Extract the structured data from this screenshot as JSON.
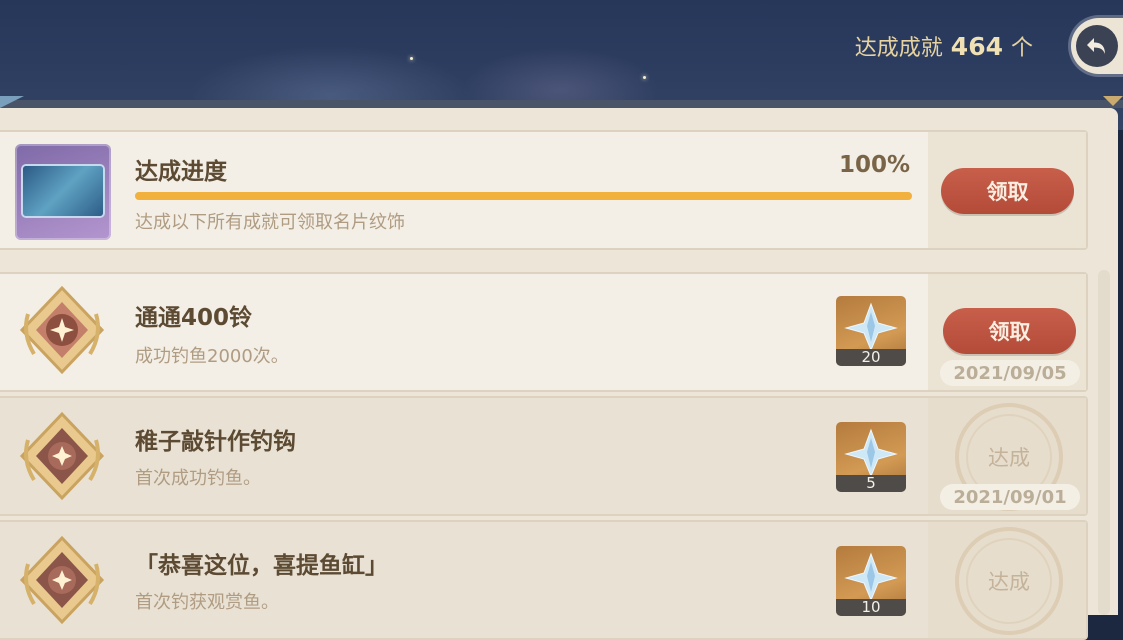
{
  "header": {
    "achieved_label": "达成成就",
    "achieved_count": "464",
    "unit": "个"
  },
  "progress": {
    "title": "达成进度",
    "percent_text": "100%",
    "fraction": 1.0,
    "subtitle": "达成以下所有成就可领取名片纹饰",
    "claim_label": "领取"
  },
  "achievements": [
    {
      "title": "通通400铃",
      "desc": "成功钓鱼2000次。",
      "reward_qty": "20",
      "action": "领取",
      "date": "2021/09/05"
    },
    {
      "title": "稚子敲针作钓钩",
      "desc": "首次成功钓鱼。",
      "reward_qty": "5",
      "stamp": "达成",
      "date": "2021/09/01"
    },
    {
      "title": "「恭喜这位，喜提鱼缸」",
      "desc": "首次钓获观赏鱼。",
      "reward_qty": "10",
      "stamp": "达成",
      "date": ""
    }
  ],
  "colors": {
    "accent": "#f1b13c",
    "claim": "#b44b39",
    "title": "#5c4a33"
  }
}
